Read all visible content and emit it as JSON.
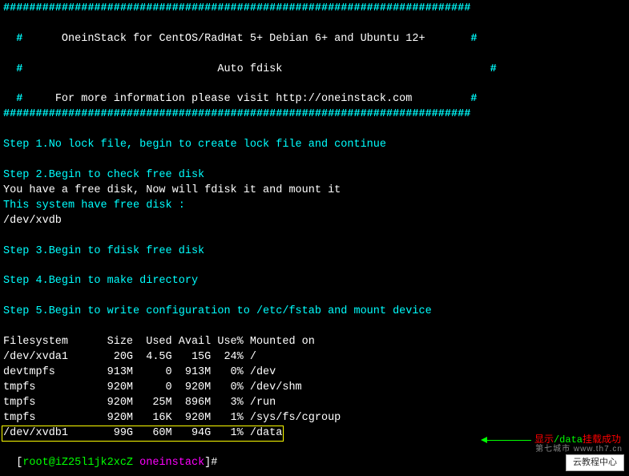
{
  "header": {
    "border": "########################################################################",
    "line1_prefix": "#      ",
    "line1_text": "OneinStack for CentOS/RadHat 5+ Debian 6+ and Ubuntu 12+",
    "line1_suffix": "       #",
    "line2_prefix": "#                              ",
    "line2_text": "Auto fdisk",
    "line2_suffix": "                                #",
    "line3_prefix": "#     ",
    "line3_text": "For more information please visit http://oneinstack.com",
    "line3_suffix": "         #"
  },
  "steps": {
    "s1": "Step 1.No lock file, begin to create lock file and continue",
    "s2": "Step 2.Begin to check free disk",
    "freedisk_msg": "You have a free disk, Now will fdisk it and mount it",
    "freedisk_have": "This system have free disk :",
    "freedisk_dev": "/dev/xvdb",
    "s3": "Step 3.Begin to fdisk free disk",
    "s4": "Step 4.Begin to make directory",
    "s5": "Step 5.Begin to write configuration to /etc/fstab and mount device"
  },
  "df": {
    "header": "Filesystem      Size  Used Avail Use% Mounted on",
    "rows": [
      "/dev/xvda1       20G  4.5G   15G  24% /",
      "devtmpfs        913M     0  913M   0% /dev",
      "tmpfs           920M     0  920M   0% /dev/shm",
      "tmpfs           920M   25M  896M   3% /run",
      "tmpfs           920M   16K  920M   1% /sys/fs/cgroup"
    ],
    "highlight": "/dev/xvdb1       99G   60M   94G   1% /data"
  },
  "annotation": {
    "pre": "显示",
    "path": "/data",
    "post": "挂载成功"
  },
  "prompt": {
    "bracket_open": "[",
    "user_host": "root@iZ25l1jk2xcZ",
    "space": " ",
    "dir": "oneinstack",
    "bracket_close": "]#",
    "cursor": " "
  },
  "watermark": {
    "box": "云教程中心",
    "site": "第七城市  www.th7.cn"
  }
}
